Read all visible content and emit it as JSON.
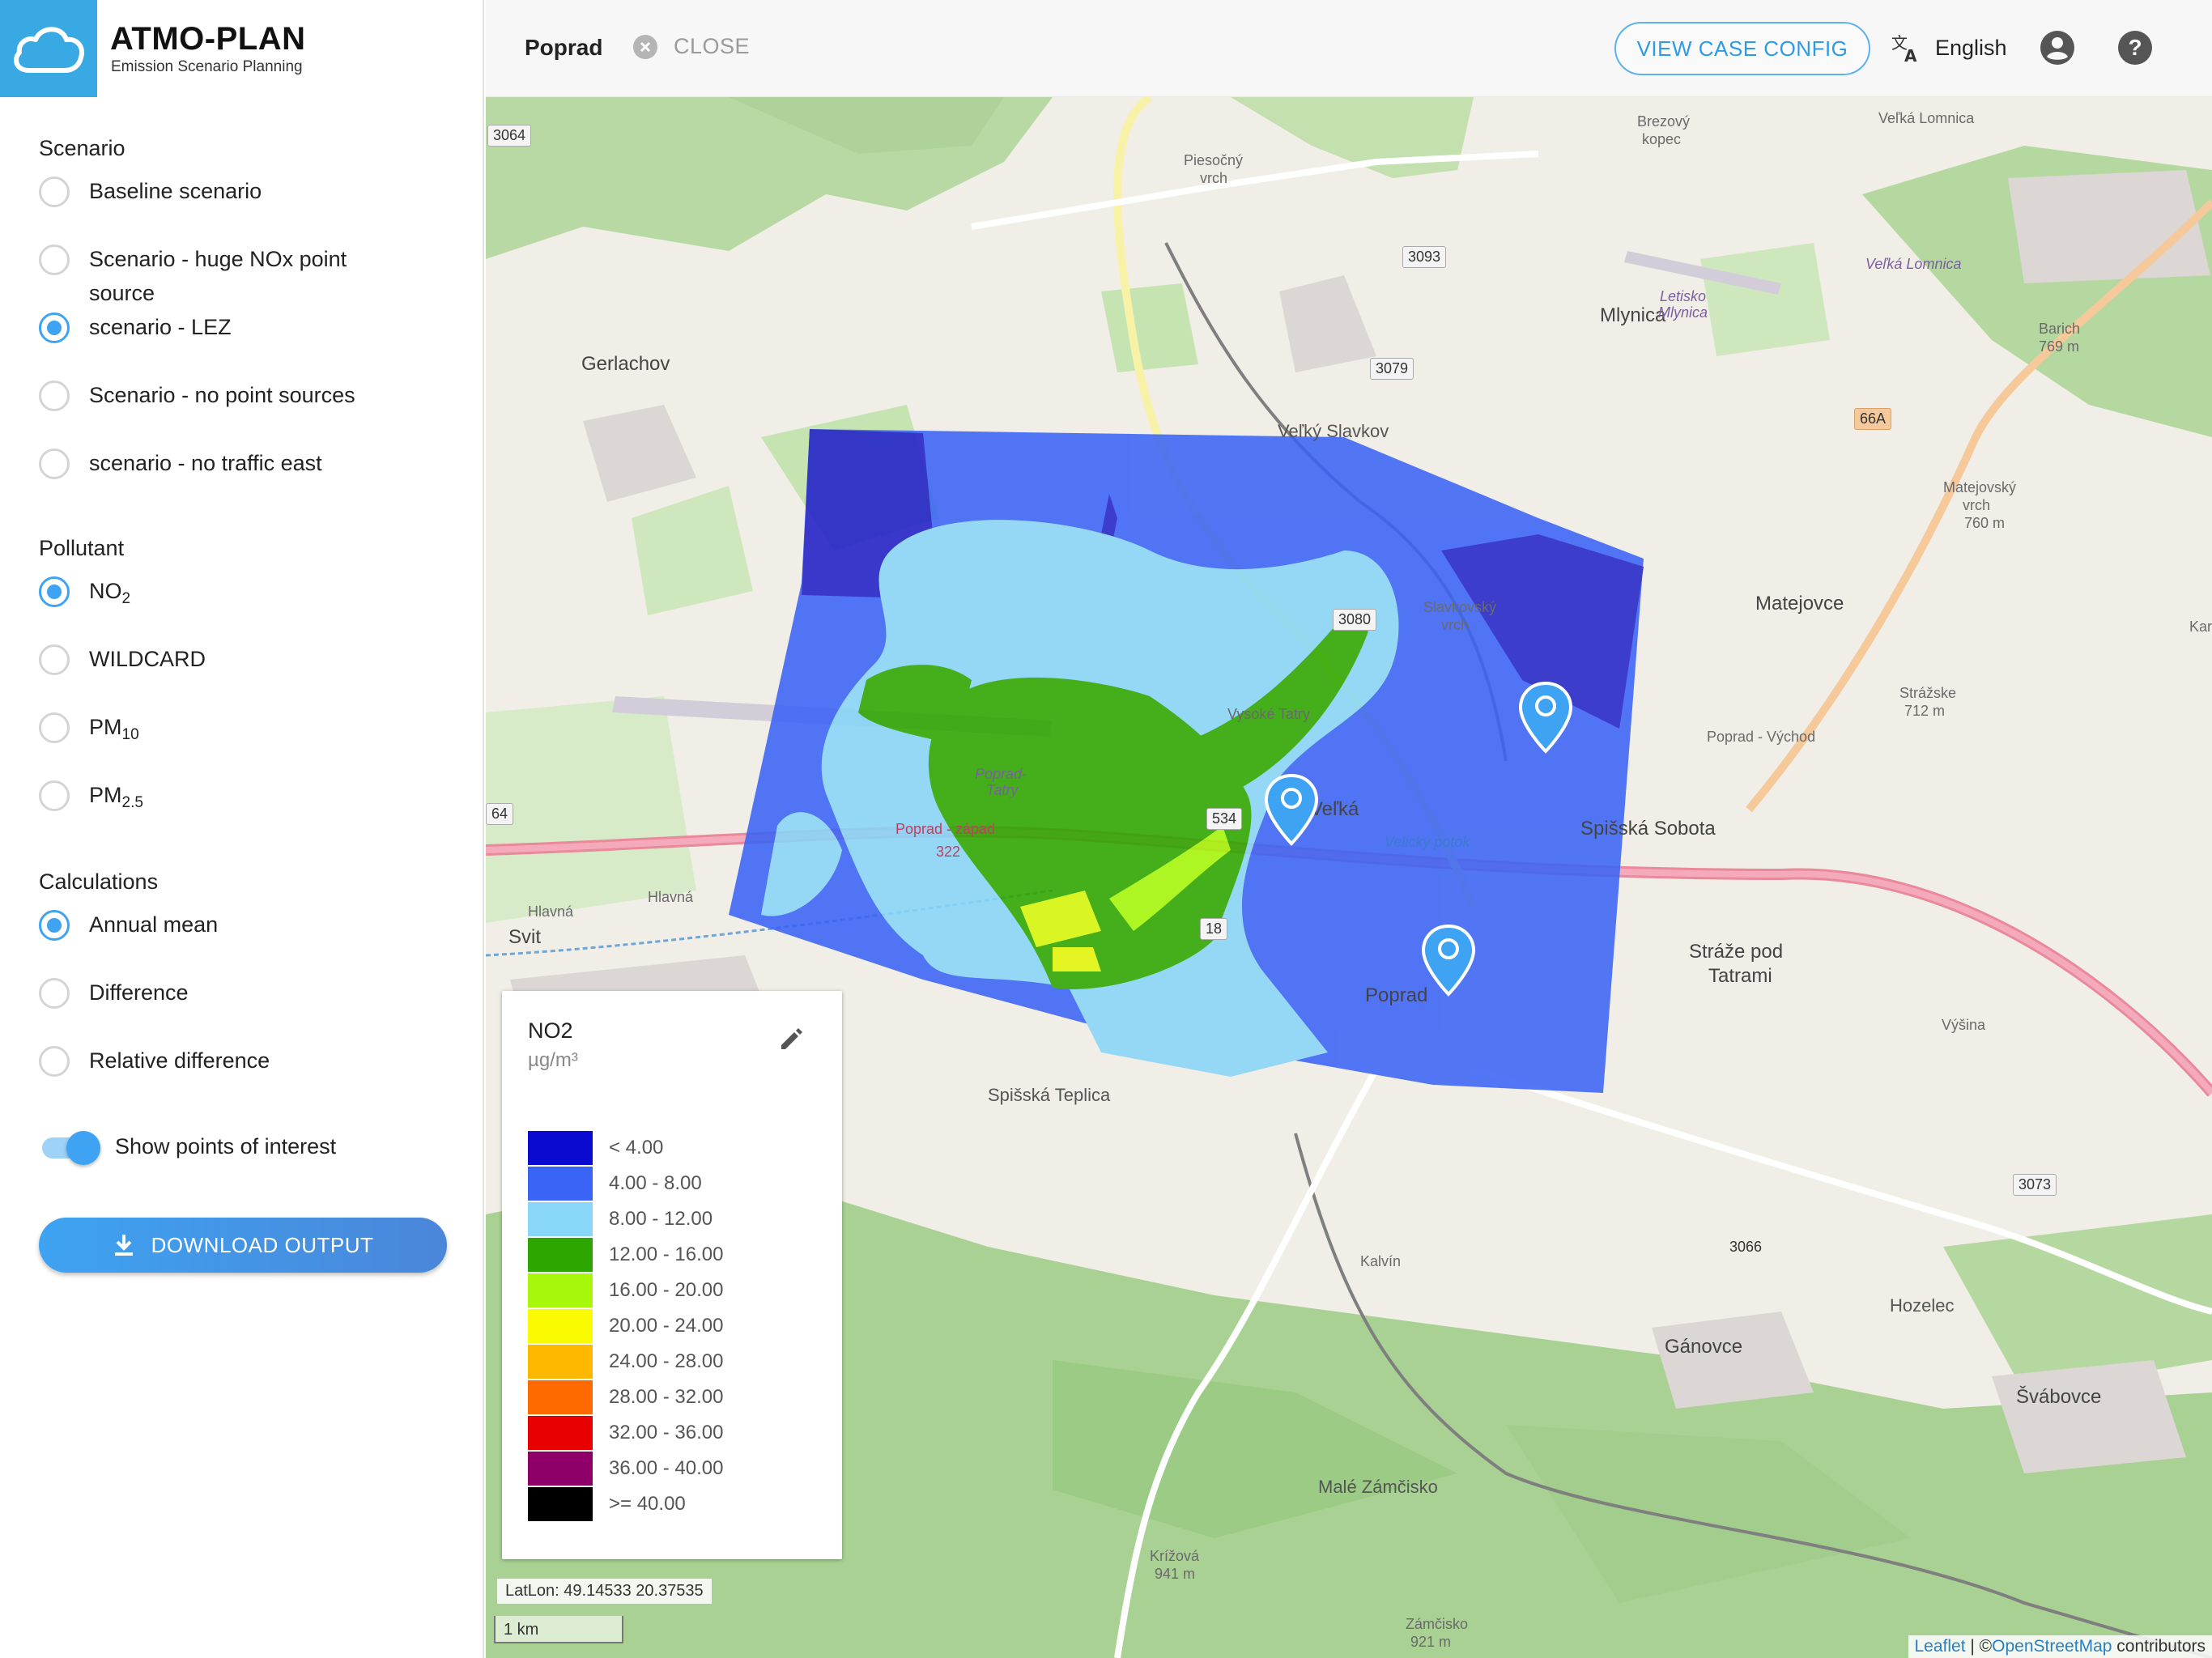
{
  "app": {
    "name": "ATMO-PLAN",
    "subtitle": "Emission Scenario Planning"
  },
  "header": {
    "tab_title": "Poprad",
    "close_label": "CLOSE",
    "case_config_label": "VIEW CASE CONFIG",
    "language": "English"
  },
  "sidebar": {
    "scenario_title": "Scenario",
    "scenarios": [
      {
        "label": "Baseline scenario",
        "selected": false
      },
      {
        "label": "Scenario - huge NOx point source",
        "selected": false
      },
      {
        "label": "scenario - LEZ",
        "selected": true
      },
      {
        "label": "Scenario - no point sources",
        "selected": false
      },
      {
        "label": "scenario - no traffic east",
        "selected": false
      }
    ],
    "pollutant_title": "Pollutant",
    "pollutants": [
      {
        "base": "NO",
        "sub": "2",
        "selected": true
      },
      {
        "base": "WILDCARD",
        "sub": "",
        "selected": false
      },
      {
        "base": "PM",
        "sub": "10",
        "selected": false
      },
      {
        "base": "PM",
        "sub": "2.5",
        "selected": false
      }
    ],
    "calculations_title": "Calculations",
    "calculations": [
      {
        "label": "Annual mean",
        "selected": true
      },
      {
        "label": "Difference",
        "selected": false
      },
      {
        "label": "Relative difference",
        "selected": false
      }
    ],
    "show_poi_label": "Show points of interest",
    "show_poi_enabled": true,
    "download_label": "DOWNLOAD OUTPUT"
  },
  "legend": {
    "title": "NO2",
    "unit": "µg/m³",
    "ranges": [
      {
        "label": "< 4.00",
        "color": "#0a0ad0"
      },
      {
        "label": "4.00 - 8.00",
        "color": "#3a64f5"
      },
      {
        "label": "8.00 - 12.00",
        "color": "#88d6f8"
      },
      {
        "label": "12.00 - 16.00",
        "color": "#2ea600"
      },
      {
        "label": "16.00 - 20.00",
        "color": "#a6f70a"
      },
      {
        "label": "20.00 - 24.00",
        "color": "#fafa00"
      },
      {
        "label": "24.00 - 28.00",
        "color": "#ffb800"
      },
      {
        "label": "28.00 - 32.00",
        "color": "#ff6a00"
      },
      {
        "label": "32.00 - 36.00",
        "color": "#e80000"
      },
      {
        "label": "36.00 - 40.00",
        "color": "#8e0068"
      },
      {
        "label": ">= 40.00",
        "color": "#000000"
      }
    ]
  },
  "map": {
    "coords": "LatLon: 49.14533 20.37535",
    "scale": "1 km",
    "attribution": {
      "leaflet": "Leaflet",
      "sep": " | ©",
      "osm": "OpenStreetMap",
      "rest": " contributors"
    },
    "places": {
      "velka_lomnica": "Veľká Lomnica",
      "brezovy": "Brezový",
      "kopec": "kopec",
      "piesocny": "Piesočný",
      "vrch": "vrch",
      "gerlachov": "Gerlachov",
      "mlynica": "Mlynica",
      "letisko": "Letisko",
      "mlynica_it": "Mlynica",
      "velka_lomnica_it": "Veľká Lomnica",
      "barich": "Barich",
      "barich_h": "769 m",
      "velky_slavkov": "Veľký Slavkov",
      "matejovsky": "Matejovský",
      "matejovsky_vrch": "vrch",
      "matejovsky_h": "760 m",
      "slavkovsky": "Slavkovský",
      "slavkovsky_vrch": "vrch",
      "matejovce": "Matejovce",
      "kar": "Kar",
      "vysoke_tatry": "Vysoké Tatry",
      "straze_h": "Strážske",
      "straze_m": "712 m",
      "poprad_vychod": "Poprad - Východ",
      "poprad_tatry": "Poprad-",
      "poprad_tatry2": "Tatry",
      "velka": "Veľká",
      "spisska_sobota": "Spišská Sobota",
      "poprad_zapad": "Poprad - západ",
      "svit": "Svit",
      "hlavna": "Hlavná",
      "hlavna2": "Hlavná",
      "poprad_town": "Poprad",
      "velicky_potok": "Velický potok",
      "straze_pod": "Stráže pod",
      "tatrami": "Tatrami",
      "vysina": "Výšina",
      "spisska_teplica": "Spišská Teplica",
      "kalvia": "Kalvín",
      "ganovce": "Gánovce",
      "hozelec": "Hozelec",
      "svabovce": "Švábovce",
      "male_zamcisko": "Malé Zámčisko",
      "krizova": "Krížová",
      "krizova_h": "941 m",
      "zamcisko": "Zámčisko",
      "zamcisko_h": "921 m",
      "poprad_text": "Poprad"
    },
    "roads": {
      "r3064": "3064",
      "r3093": "3093",
      "r3079": "3079",
      "r66a": "66A",
      "r3080": "3080",
      "r64": "64",
      "r18": "18",
      "r534": "534",
      "r322": "322",
      "r3073": "3073",
      "r3066": "3066"
    }
  }
}
